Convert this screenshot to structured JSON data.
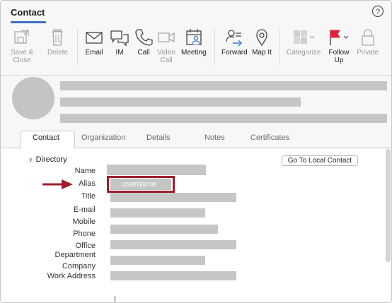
{
  "ribbon": {
    "tab_label": "Contact",
    "buttons": [
      {
        "label": "Save &\nClose",
        "icon": "save-close-icon",
        "disabled": true
      },
      {
        "label": "Delete",
        "icon": "trash-icon",
        "disabled": true
      },
      {
        "label": "Email",
        "icon": "envelope-icon",
        "disabled": false
      },
      {
        "label": "IM",
        "icon": "chat-bubbles-icon",
        "disabled": false
      },
      {
        "label": "Call",
        "icon": "phone-icon",
        "disabled": false
      },
      {
        "label": "Video\nCall",
        "icon": "video-camera-icon",
        "disabled": true
      },
      {
        "label": "Meeting",
        "icon": "calendar-person-icon",
        "disabled": false
      },
      {
        "label": "Forward",
        "icon": "forward-contact-icon",
        "disabled": false
      },
      {
        "label": "Map It",
        "icon": "map-pin-icon",
        "disabled": false
      },
      {
        "label": "Categorize",
        "icon": "categorize-icon",
        "disabled": true
      },
      {
        "label": "Follow\nUp",
        "icon": "flag-icon",
        "disabled": false
      },
      {
        "label": "Private",
        "icon": "lock-icon",
        "disabled": true
      }
    ]
  },
  "tabs": [
    "Contact",
    "Organization",
    "Details",
    "Notes",
    "Certificates"
  ],
  "directory": {
    "section_label": "Directory",
    "go_local_label": "Go To Local Contact",
    "fields": [
      "Name",
      "Alias",
      "Title",
      "E-mail",
      "Mobile",
      "Phone",
      "Office",
      "Department",
      "Company",
      "Work Address"
    ],
    "alias_value": "username"
  },
  "colors": {
    "accent": "#3a6fc4",
    "highlight": "#a01d2b",
    "redaction": "#c4c4c4",
    "flag": "#e0213c"
  }
}
